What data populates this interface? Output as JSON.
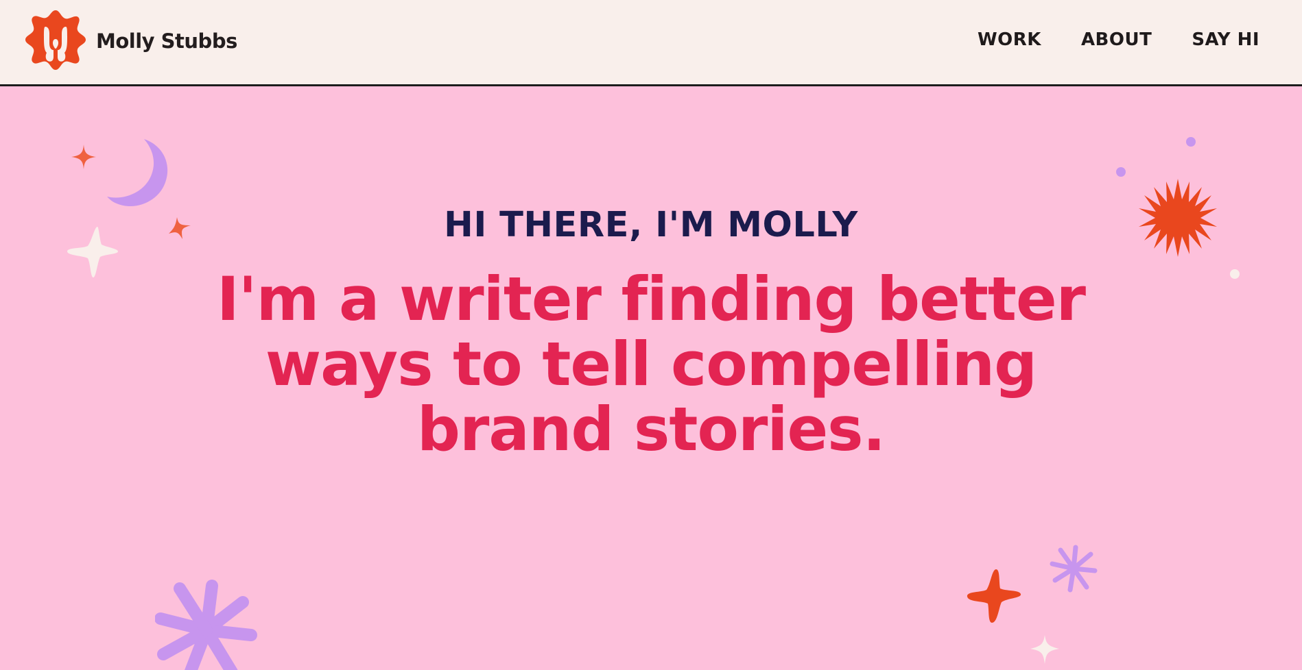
{
  "header": {
    "brand_name": "Molly Stubbs",
    "logo_icon": "flower-logo-icon",
    "nav": [
      {
        "label": "WORK"
      },
      {
        "label": "ABOUT"
      },
      {
        "label": "SAY HI"
      }
    ]
  },
  "hero": {
    "eyebrow": "HI THERE, I'M MOLLY",
    "headline": "I'm a writer finding better ways to tell compelling brand stories."
  },
  "colors": {
    "header_bg": "#f9efeb",
    "hero_bg": "#fdc0db",
    "headline": "#e32452",
    "eyebrow": "#1b1b4d",
    "accent_orange": "#e9471e",
    "accent_purple": "#c795ee",
    "cream": "#f9efeb"
  },
  "decorations": [
    "sparkle-icon",
    "crescent-moon-icon",
    "starburst-icon",
    "asterisk-flower-icon",
    "dot-icon"
  ]
}
